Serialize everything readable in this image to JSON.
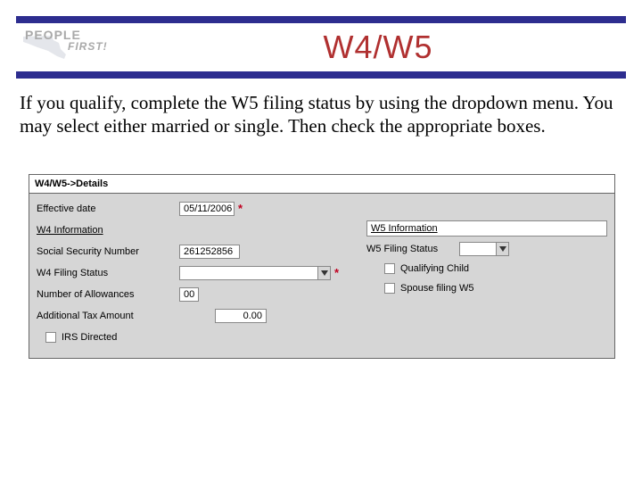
{
  "logo": {
    "text_top": "PEOPLE",
    "text_bottom": "FIRST!"
  },
  "title": "W4/W5",
  "instruction": "If you qualify, complete the W5 filing status by using the dropdown menu.  You may select either married or single.  Then check the appropriate boxes.",
  "form": {
    "breadcrumb": "W4/W5->Details",
    "left": {
      "effective_date_label": "Effective date",
      "effective_date_value": "05/11/2006",
      "w4_info_label": "W4 Information",
      "ssn_label": "Social Security Number",
      "ssn_value": "261252856",
      "filing_label": "W4 Filing Status",
      "filing_value": "",
      "allowances_label": "Number of Allowances",
      "allowances_value": "00",
      "addl_tax_label": "Additional Tax Amount",
      "addl_tax_value": "0.00",
      "irs_directed_label": "IRS Directed"
    },
    "right": {
      "w5_info_label": "W5 Information",
      "w5_filing_label": "W5 Filing Status",
      "w5_filing_value": "",
      "qualifying_child_label": "Qualifying Child",
      "spouse_w5_label": "Spouse filing W5"
    },
    "asterisk": "*"
  }
}
